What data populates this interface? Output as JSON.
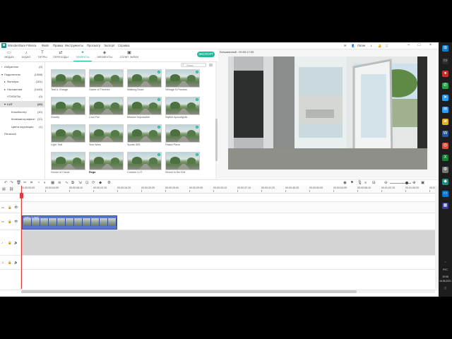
{
  "title_bar": {
    "app_name": "Wondershare Filmora",
    "menu": [
      "Файл",
      "Правка",
      "Инструменты",
      "Просмотр",
      "Экспорт",
      "Справка"
    ],
    "login": "Логин"
  },
  "media_tabs": [
    {
      "label": "МЕДИА",
      "icon": "folder-icon"
    },
    {
      "label": "АУДИО",
      "icon": "music-note-icon"
    },
    {
      "label": "ТИТРЫ",
      "icon": "text-icon"
    },
    {
      "label": "ПЕРЕХОДЫ",
      "icon": "transition-icon"
    },
    {
      "label": "ЭФФЕКТЫ",
      "icon": "effects-icon",
      "active": true
    },
    {
      "label": "ЭЛЕМЕНТЫ",
      "icon": "elements-icon"
    },
    {
      "label": "СПЛИТ ЭКРАН",
      "icon": "split-screen-icon"
    }
  ],
  "export_label": "ЭКСПОРТ",
  "sidebar": [
    {
      "name": "Избранное",
      "count": "(0)",
      "arrow": "›",
      "indent": 2
    },
    {
      "name": "Подключено",
      "count": "(1368)",
      "arrow": "▾",
      "indent": 2
    },
    {
      "name": "Фильтры",
      "count": "(161)",
      "arrow": "▸",
      "indent": 6
    },
    {
      "name": "Наложения",
      "count": "(1440)",
      "arrow": "▸",
      "indent": 6
    },
    {
      "name": "УТИЛИТЫ",
      "count": "(0)",
      "arrow": "",
      "indent": 6
    },
    {
      "name": "LUT",
      "count": "(20)",
      "arrow": "▾",
      "indent": 6,
      "active": true
    },
    {
      "name": "Блокбастер",
      "count": "(10)",
      "arrow": "",
      "indent": 12
    },
    {
      "name": "Кинематографичн",
      "count": "(12)",
      "arrow": "",
      "indent": 12
    },
    {
      "name": "Цвета коррекция",
      "count": "(1)",
      "arrow": "",
      "indent": 12
    },
    {
      "name": "Filmstock",
      "count": "",
      "arrow": "",
      "indent": 2
    }
  ],
  "search_placeholder": "Поиск",
  "effects": [
    "Teal & Orange",
    "Game of Thrones",
    "Walking Dead",
    "Vintage II-Process",
    "Gravity",
    "Cool Fun",
    "Mission Impossible",
    "Stylish Apocalyptic",
    "Light Teal",
    "Star Wars",
    "Sports 305",
    "Pastel Piece",
    "House of Cards",
    "Rego",
    "Custom LUT",
    "Struck in the Dirt"
  ],
  "active_effect": "Rego",
  "preview": {
    "title": "Безымянный : 00:00:17:05",
    "timecode": "00:00:00:00",
    "quality": "Полное"
  },
  "ruler_ticks": [
    "00:00:00:00",
    "00:00:04:05",
    "00:00:08:10",
    "00:00:12:15",
    "00:00:16:20",
    "00:00:20:25",
    "00:00:25:00",
    "00:00:29:05",
    "00:00:33:10",
    "00:00:37:15",
    "00:00:41:20",
    "00:00:45:25",
    "00:00:50:00",
    "00:00:54:05",
    "00:00:58:10",
    "00:01:02:15",
    "00:01:06:20",
    "00:01:10:2"
  ],
  "clip_label": "video_1.mp4",
  "taskbar": {
    "lang": "РУС",
    "time": "19:08",
    "date": "16.06.2021"
  },
  "colors": {
    "accent": "#22b89b",
    "clip": "#5a76c6",
    "playhead": "#e03b3b"
  }
}
